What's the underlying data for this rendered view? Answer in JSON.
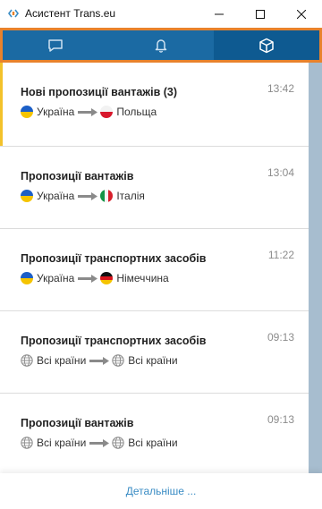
{
  "window": {
    "title": "Асистент Trans.eu"
  },
  "tabs": [
    {
      "name": "messages",
      "icon": "chat-icon",
      "active": false
    },
    {
      "name": "notifications",
      "icon": "bell-icon",
      "active": false
    },
    {
      "name": "offers",
      "icon": "box-icon",
      "active": true
    }
  ],
  "feed": [
    {
      "title": "Нові пропозиції вантажів (3)",
      "time": "13:42",
      "unread": true,
      "from": {
        "label": "Україна",
        "flag": "ua"
      },
      "to": {
        "label": "Польща",
        "flag": "pl"
      }
    },
    {
      "title": "Пропозиції вантажів",
      "time": "13:04",
      "unread": false,
      "from": {
        "label": "Україна",
        "flag": "ua"
      },
      "to": {
        "label": "Італія",
        "flag": "it"
      }
    },
    {
      "title": "Пропозиції транспортних засобів",
      "time": "11:22",
      "unread": false,
      "from": {
        "label": "Україна",
        "flag": "ua"
      },
      "to": {
        "label": "Німеччина",
        "flag": "de"
      }
    },
    {
      "title": "Пропозиції транспортних засобів",
      "time": "09:13",
      "unread": false,
      "from": {
        "label": "Всі країни",
        "flag": "globe"
      },
      "to": {
        "label": "Всі країни",
        "flag": "globe"
      }
    },
    {
      "title": "Пропозиції вантажів",
      "time": "09:13",
      "unread": false,
      "from": {
        "label": "Всі країни",
        "flag": "globe"
      },
      "to": {
        "label": "Всі країни",
        "flag": "globe"
      }
    }
  ],
  "footer": {
    "details_label": "Детальніше ..."
  },
  "colors": {
    "tabbar": "#1b6aa3",
    "tabbar_border": "#e8822c",
    "unread_marker": "#f3c22b",
    "link": "#3a8cc4"
  }
}
